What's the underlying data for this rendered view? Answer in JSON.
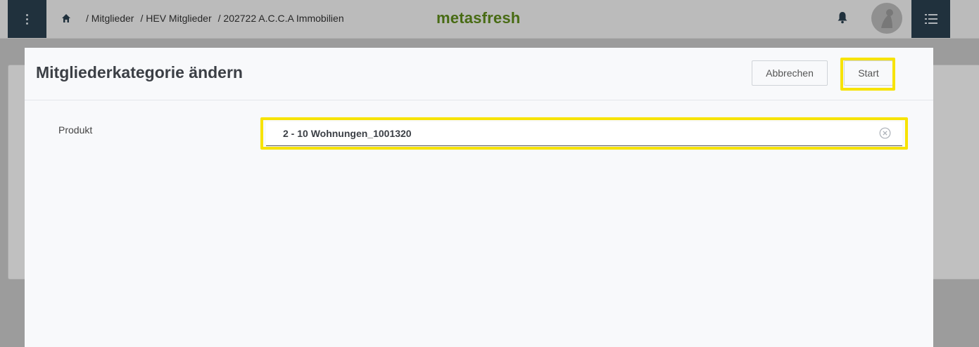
{
  "header": {
    "breadcrumb": [
      "/ Mitglieder",
      "/ HEV Mitglieder",
      "/ 202722 A.C.C.A Immobilien"
    ],
    "brand": "metasfresh",
    "icons": [
      "menu-icon",
      "home-icon",
      "bell-icon",
      "avatar",
      "list-icon"
    ]
  },
  "modal": {
    "title": "Mitgliederkategorie ändern",
    "cancel_label": "Abbrechen",
    "start_label": "Start",
    "field": {
      "label": "Produkt",
      "value": "2 - 10 Wohnungen_1001320",
      "clear_icon": "clear-circle-icon"
    }
  },
  "colors": {
    "brand": "#5d8a1a",
    "nav_dark": "#2a3f4f",
    "highlight": "#f7e300"
  }
}
